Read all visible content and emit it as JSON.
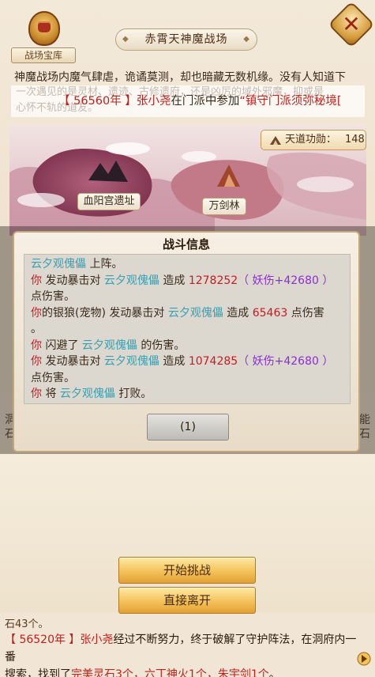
{
  "header": {
    "treasure_label": "战场宝库",
    "title": "赤霄天神魔战场"
  },
  "description": {
    "text": "神魔战场内魔气肆虐，诡谲莫测，却也暗藏无数机缘。没有人知道下",
    "ghost_line_1": "一次遇见的是灵材、遗迹、古修遗府，还是凶厉的域外邪魔，抑或是",
    "ghost_line_2": "心怀不轨的道友。"
  },
  "news": {
    "year": "【 56560年 】",
    "name": "张小尧",
    "mid": "在门派中参加",
    "event": "“镇守门派须弥秘境["
  },
  "map": {
    "tiandao_label": "天道功勋：",
    "tiandao_value": "148",
    "places": [
      "血阳宫遗址",
      "万剑林"
    ]
  },
  "battle": {
    "title": "战斗信息",
    "lines": [
      [
        {
          "t": "云夕观傀儡",
          "c": "cyan"
        },
        {
          "t": " 上阵。",
          "c": ""
        }
      ],
      [
        {
          "t": "你",
          "c": "dred"
        },
        {
          "t": " 发动暴击对 ",
          "c": ""
        },
        {
          "t": "云夕观傀儡",
          "c": "cyan"
        },
        {
          "t": " 造成 ",
          "c": ""
        },
        {
          "t": "1278252",
          "c": "dred"
        },
        {
          "t": "（ 妖伤+42680 ）",
          "c": "purple"
        }
      ],
      [
        {
          "t": "点伤害。",
          "c": ""
        }
      ],
      [
        {
          "t": "你",
          "c": "dred"
        },
        {
          "t": "的银狼(宠物) 发动暴击对 ",
          "c": ""
        },
        {
          "t": "云夕观傀儡",
          "c": "cyan"
        },
        {
          "t": " 造成 ",
          "c": ""
        },
        {
          "t": "65463",
          "c": "dred"
        },
        {
          "t": " 点伤害",
          "c": ""
        }
      ],
      [
        {
          "t": "。",
          "c": ""
        }
      ],
      [
        {
          "t": "你",
          "c": "dred"
        },
        {
          "t": " 闪避了 ",
          "c": ""
        },
        {
          "t": "云夕观傀儡",
          "c": "cyan"
        },
        {
          "t": " 的伤害。",
          "c": ""
        }
      ],
      [
        {
          "t": "你",
          "c": "dred"
        },
        {
          "t": " 发动暴击对 ",
          "c": ""
        },
        {
          "t": "云夕观傀儡",
          "c": "cyan"
        },
        {
          "t": " 造成 ",
          "c": ""
        },
        {
          "t": "1074285",
          "c": "dred"
        },
        {
          "t": "（ 妖伤+42680 ）",
          "c": "purple"
        }
      ],
      [
        {
          "t": "点伤害。",
          "c": ""
        }
      ],
      [
        {
          "t": "你",
          "c": "dred"
        },
        {
          "t": " 将 ",
          "c": ""
        },
        {
          "t": "云夕观傀儡",
          "c": "cyan"
        },
        {
          "t": " 打败。",
          "c": ""
        }
      ]
    ],
    "button_label": "(1)"
  },
  "side": {
    "left_glyph_1": "洞",
    "left_glyph_2": "石",
    "right_glyph_1": "能",
    "right_glyph_2": "石"
  },
  "actions": {
    "start_label": "开始挑战",
    "leave_label": "直接离开"
  },
  "bottom_log": {
    "prev_tail": "石43个。",
    "year": "【 56520年 】",
    "name": "张小尧",
    "text_1": "经过不断努力，终于破解了守护阵法，在洞府内一番",
    "text_2a": "搜索，找到了",
    "items": "完美灵石3个，六丁神火1个，朱宇剑1个",
    "text_2b": "。"
  },
  "colors": {
    "accent_red": "#c21f1a",
    "cyan": "#3a9fb0",
    "purple": "#8a2fd4",
    "gold_button": "#f4c25a"
  }
}
